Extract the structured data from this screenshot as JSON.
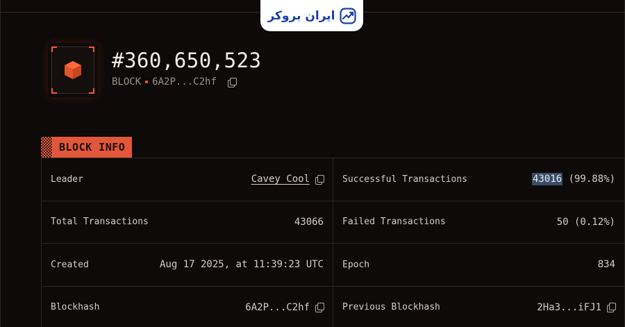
{
  "brand": {
    "logo_text": "ایران بروکر"
  },
  "header": {
    "block_number": "#360,650,523",
    "kind": "BLOCK",
    "hash_short": "6A2P...C2hf"
  },
  "section": {
    "title": "BLOCK INFO"
  },
  "rows": [
    {
      "left": {
        "label": "Leader",
        "value": "Cavey Cool"
      },
      "right": {
        "label": "Successful Transactions",
        "value_highlight": "43016",
        "value_rest": " (99.88%)"
      }
    },
    {
      "left": {
        "label": "Total Transactions",
        "value": "43066"
      },
      "right": {
        "label": "Failed Transactions",
        "value": "50 (0.12%)"
      }
    },
    {
      "left": {
        "label": "Created",
        "value": "Aug 17 2025, at 11:39:23 UTC"
      },
      "right": {
        "label": "Epoch",
        "value": "834"
      }
    },
    {
      "left": {
        "label": "Blockhash",
        "value": "6A2P...C2hf"
      },
      "right": {
        "label": "Previous Blockhash",
        "value": "2Ha3...iFJ1"
      }
    }
  ],
  "colors": {
    "accent": "#e2573a",
    "background": "#0d0a09",
    "highlight": "#3b4d66",
    "brand": "#1a3fa6"
  }
}
